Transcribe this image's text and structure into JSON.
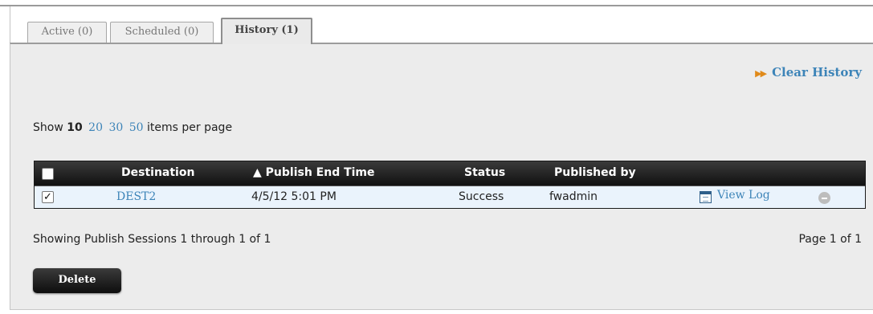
{
  "tabs": [
    {
      "label": "Active (0)"
    },
    {
      "label": "Scheduled (0)"
    },
    {
      "label": "History (1)"
    }
  ],
  "clear_history": {
    "label": "Clear History"
  },
  "per_page": {
    "prefix": "Show",
    "current": "10",
    "options": [
      "20",
      "30",
      "50"
    ],
    "suffix": "items per page"
  },
  "table": {
    "columns": [
      "Destination",
      "▲ Publish End Time",
      "Status",
      "Published by"
    ],
    "rows": [
      {
        "checked": true,
        "destination": "DEST2",
        "end_time": "4/5/12 5:01 PM",
        "status": "Success",
        "published_by": "fwadmin",
        "view_log": "View Log"
      }
    ]
  },
  "summary": "Showing Publish Sessions 1 through 1 of 1",
  "page_info": "Page 1 of 1",
  "delete_button": "Delete",
  "icons": {
    "clear_history": "double-chevron-right-icon",
    "view_log": "log-window-icon",
    "remove": "remove-circle-icon"
  }
}
